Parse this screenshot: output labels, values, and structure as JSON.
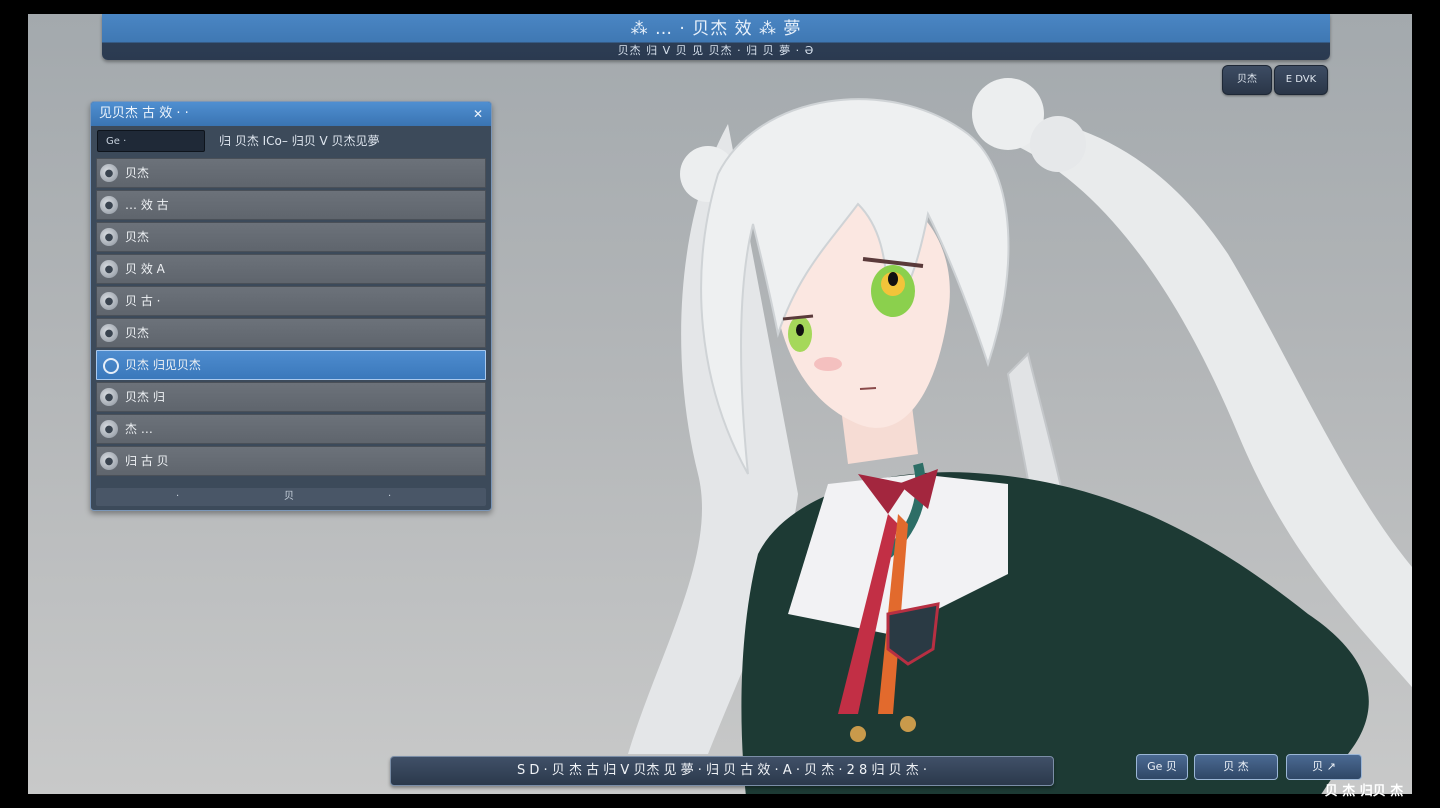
{
  "topbar": {
    "title": "⁂ … · 贝杰 效 ⁂ 夢",
    "subtitle": "贝杰 归 V 贝 见 贝杰 · 归 贝 夢 · Ә"
  },
  "top_buttons": [
    "贝杰",
    "E DVK"
  ],
  "panel": {
    "title": "见贝杰 古 效 · ·",
    "close": "✕",
    "filter_value": "Ge ·",
    "header": "归 贝杰 ICo– 归贝 V 贝杰见夢",
    "rows": [
      {
        "label": "贝杰",
        "selected": false
      },
      {
        "label": "… 效 古",
        "selected": false
      },
      {
        "label": "贝杰",
        "selected": false
      },
      {
        "label": "贝 效 A",
        "selected": false
      },
      {
        "label": "贝 古 ·",
        "selected": false
      },
      {
        "label": "贝杰",
        "selected": false
      },
      {
        "label": "贝杰 归见贝杰",
        "selected": true
      },
      {
        "label": "贝杰 归",
        "selected": false
      },
      {
        "label": "杰 …",
        "selected": false
      },
      {
        "label": "归 古 贝",
        "selected": false
      }
    ],
    "footer": [
      "·",
      "贝",
      "·"
    ]
  },
  "caption": "S D · 贝 杰 古 归 V 贝杰 见 夢 · 归 贝 古 效 · A · 贝 杰 · 2 8 归 贝 杰 ·",
  "bottom_buttons": [
    "Ge 贝",
    "贝 杰",
    "贝 ↗"
  ],
  "brand": "贝 杰 归贝 杰"
}
